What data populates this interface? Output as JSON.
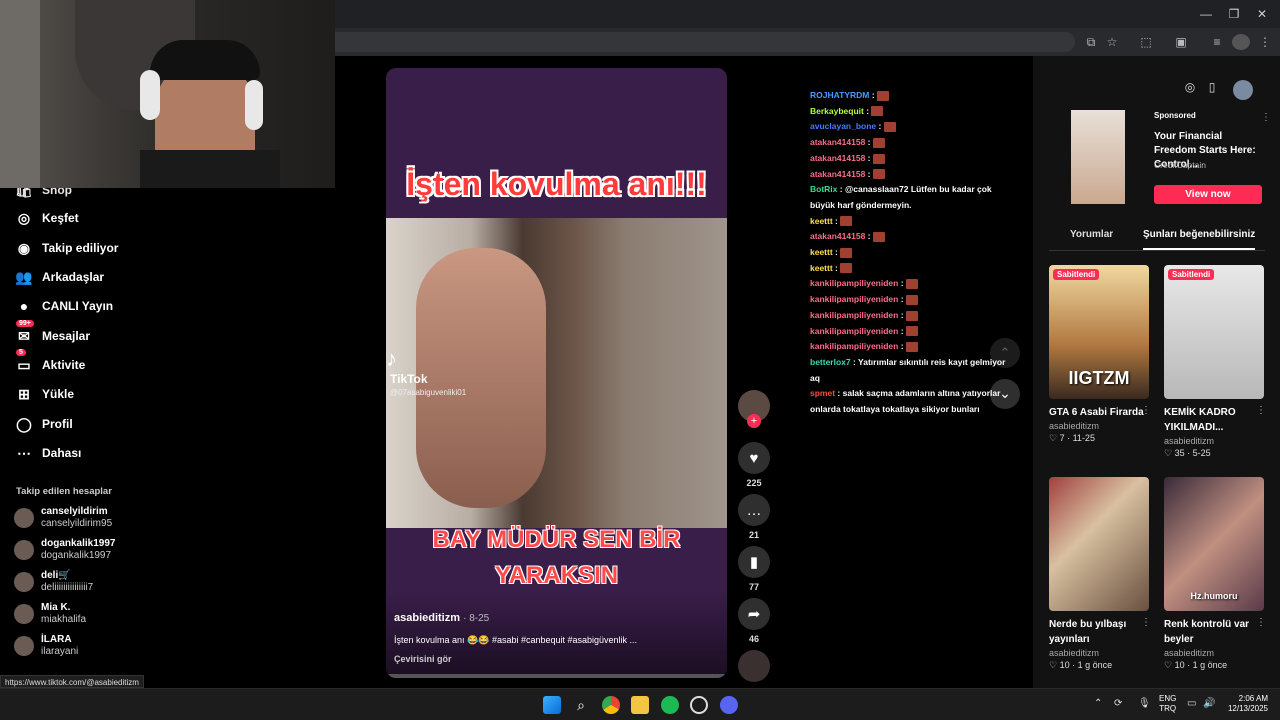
{
  "colors": {
    "accent": "#fe2c55",
    "link_blue": "#4a9bff"
  },
  "browser": {
    "icons": [
      "minimize-icon",
      "restore-icon",
      "close-icon"
    ]
  },
  "sidebar": {
    "items": [
      {
        "label": "Shop",
        "icon": "shop-icon"
      },
      {
        "label": "Keşfet",
        "icon": "compass-icon"
      },
      {
        "label": "Takip ediliyor",
        "icon": "following-icon"
      },
      {
        "label": "Arkadaşlar",
        "icon": "friends-icon"
      },
      {
        "label": "CANLI Yayın",
        "icon": "live-icon"
      },
      {
        "label": "Mesajlar",
        "icon": "message-icon",
        "badge": "99+"
      },
      {
        "label": "Aktivite",
        "icon": "activity-icon",
        "badge": "5"
      },
      {
        "label": "Yükle",
        "icon": "upload-icon"
      },
      {
        "label": "Profil",
        "icon": "profile-icon"
      },
      {
        "label": "Dahası",
        "icon": "more-icon"
      }
    ],
    "following_title": "Takip edilen hesaplar",
    "following": [
      {
        "name": "canselyildirim",
        "user": "canselyildirim95"
      },
      {
        "name": "dogankalik1997",
        "user": "dogankalik1997"
      },
      {
        "name": "deli🛒",
        "user": "deliiiiiiiiiiiiiii7"
      },
      {
        "name": "Mia K.",
        "user": "miakhalifa"
      },
      {
        "name": "İLARA",
        "user": "ilarayani"
      }
    ]
  },
  "status_url": "https://www.tiktok.com/@asabieditizm",
  "video": {
    "title_top": "İşten kovulma anı!!!",
    "title_bottom_1": "BAY MÜDÜR SEN BİR",
    "title_bottom_2": "YARAKSIN",
    "watermark": "TikTok",
    "watermark_user": "@07asabiguvenliki01",
    "author": "asabieditizm",
    "date": "· 8-25",
    "caption": "İşten kovulma anı 😂😂 #asabi #canbequit #asabigüvenlik ...",
    "translate": "Çevirisini gör"
  },
  "actions": {
    "likes": "225",
    "comments": "21",
    "saves": "77",
    "shares": "46"
  },
  "chat": [
    {
      "user": "ROJHATYRDM",
      "color": "#4a9bff",
      "msg": ""
    },
    {
      "user": "Berkaybequit",
      "color": "#b4ff3c",
      "msg": ""
    },
    {
      "user": "avuclayan_bone",
      "color": "#4a7bff",
      "msg": ""
    },
    {
      "user": "atakan414158",
      "color": "#ff6b8a",
      "msg": ""
    },
    {
      "user": "atakan414158",
      "color": "#ff6b8a",
      "msg": ""
    },
    {
      "user": "atakan414158",
      "color": "#ff6b8a",
      "msg": ""
    },
    {
      "user": "BotRix",
      "color": "#3cdc8c",
      "msg": "@canasslaan72 Lütfen bu kadar çok"
    },
    {
      "user": "",
      "color": "#ffffff",
      "msg": "büyük harf göndermeyin."
    },
    {
      "user": "keettt",
      "color": "#ffe14a",
      "msg": ""
    },
    {
      "user": "atakan414158",
      "color": "#ff6b8a",
      "msg": ""
    },
    {
      "user": "keettt",
      "color": "#ffe14a",
      "msg": ""
    },
    {
      "user": "keettt",
      "color": "#ffe14a",
      "msg": ""
    },
    {
      "user": "kankilipampiliyeniden",
      "color": "#ff6b8a",
      "msg": ""
    },
    {
      "user": "kankilipampiliyeniden",
      "color": "#ff6b8a",
      "msg": ""
    },
    {
      "user": "kankilipampiliyeniden",
      "color": "#ff6b8a",
      "msg": ""
    },
    {
      "user": "kankilipampiliyeniden",
      "color": "#ff6b8a",
      "msg": ""
    },
    {
      "user": "kankilipampiliyeniden",
      "color": "#ff6b8a",
      "msg": ""
    },
    {
      "user": "betterlox7",
      "color": "#3cdcb4",
      "msg": "Yatırımlar sıkıntılı reis kayıt gelmiyor"
    },
    {
      "user": "",
      "color": "#ffffff",
      "msg": "aq"
    },
    {
      "user": "spmet",
      "color": "#ff4a4a",
      "msg": "salak saçma adamların altına yatıyorlar"
    },
    {
      "user": "",
      "color": "#ffffff",
      "msg": "onlarda tokatlaya tokatlaya sikiyor bunları"
    }
  ],
  "ad": {
    "sponsored": "Sponsored",
    "title": "Your Financial Freedom Starts Here: Control...",
    "brand": "CreditCaptain",
    "cta": "View now"
  },
  "tabs": [
    "Yorumlar",
    "Şunları beğenebilirsiniz"
  ],
  "cards": [
    {
      "pinned": "Sabitlendi",
      "title": "GTA 6 Asabi Firarda",
      "user": "asabieditizm",
      "likes": "7",
      "date": "11-25",
      "thumb_text": "IIGTZM"
    },
    {
      "pinned": "Sabitlendi",
      "title": "KEMİK KADRO YIKILMADI...",
      "user": "asabieditizm",
      "likes": "35",
      "date": "5-25",
      "thumb_text": ""
    },
    {
      "pinned": "",
      "title": "Nerde bu yılbaşı yayınları",
      "user": "asabieditizm",
      "likes": "10",
      "date": "1 g önce",
      "thumb_text": ""
    },
    {
      "pinned": "",
      "title": "Renk kontrolü var beyler",
      "user": "asabieditizm",
      "likes": "10",
      "date": "1 g önce",
      "thumb_text": "Hz.humoru"
    }
  ],
  "taskbar": {
    "lang1": "ENG",
    "lang2": "TRQ",
    "time": "2:06 AM",
    "date": "12/13/2025"
  }
}
